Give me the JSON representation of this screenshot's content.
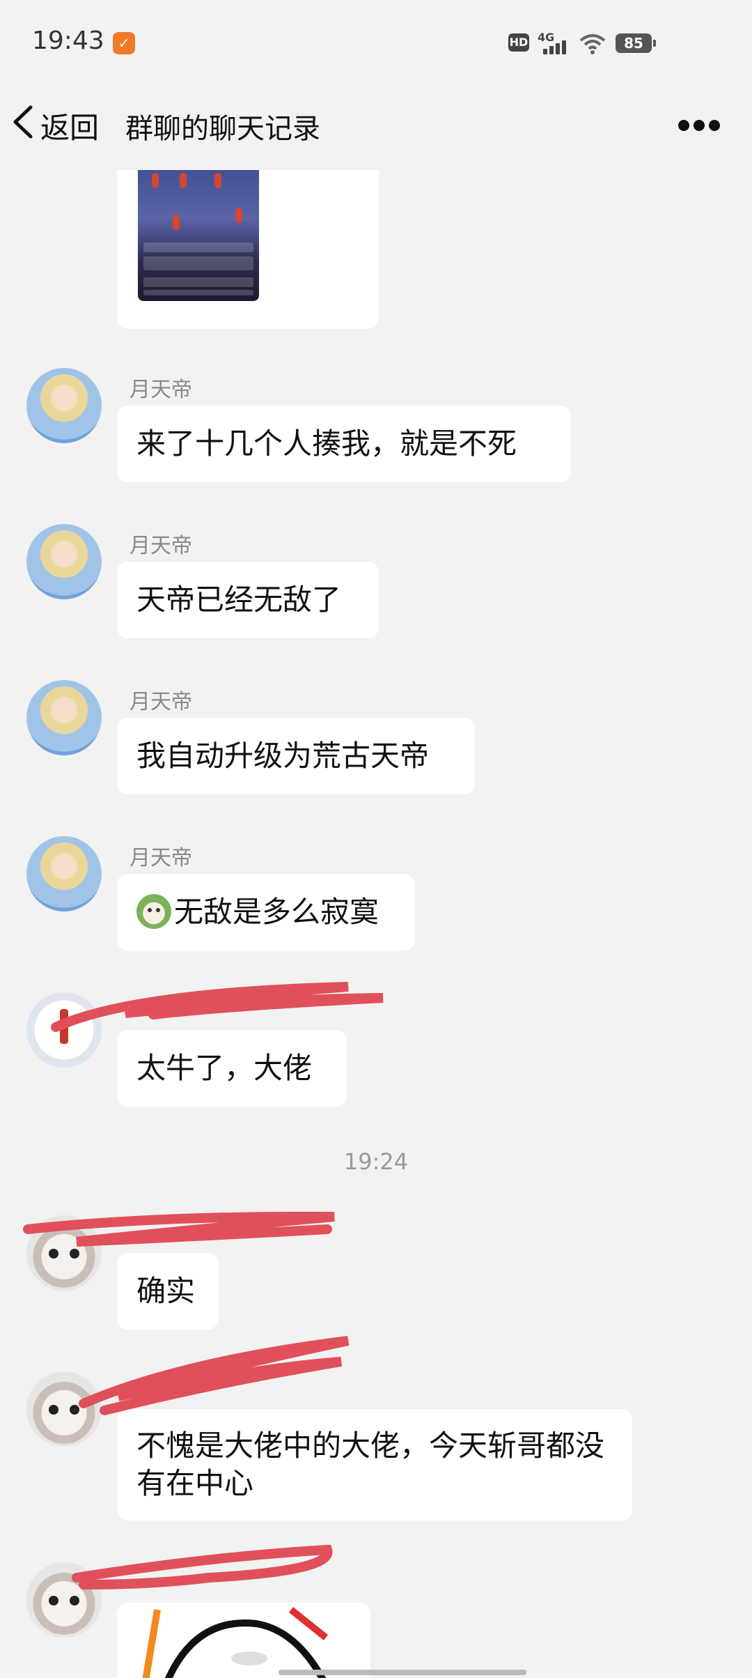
{
  "status": {
    "time": "19:43",
    "hd_label": "HD",
    "network_label": "4G",
    "battery": "85"
  },
  "nav": {
    "back_label": "返回",
    "title": "群聊的聊天记录",
    "more_icon": "more-dots-icon"
  },
  "messages": [
    {
      "sender": "月天帝",
      "text": "来了十几个人揍我，就是不死"
    },
    {
      "sender": "月天帝",
      "text": "天帝已经无敌了"
    },
    {
      "sender": "月天帝",
      "text": "我自动升级为荒古天帝"
    },
    {
      "sender": "月天帝",
      "text": "无敌是多么寂寞"
    },
    {
      "sender": "",
      "text": "太牛了，大佬"
    },
    {
      "sender": "",
      "text": "确实"
    },
    {
      "sender": "",
      "text": "不愧是大佬中的大佬，今天斩哥都没有在中心"
    }
  ],
  "timestamp": "19:24",
  "colors": {
    "background": "#f2f2f2",
    "bubble": "#ffffff",
    "scribble": "#e0505a"
  }
}
